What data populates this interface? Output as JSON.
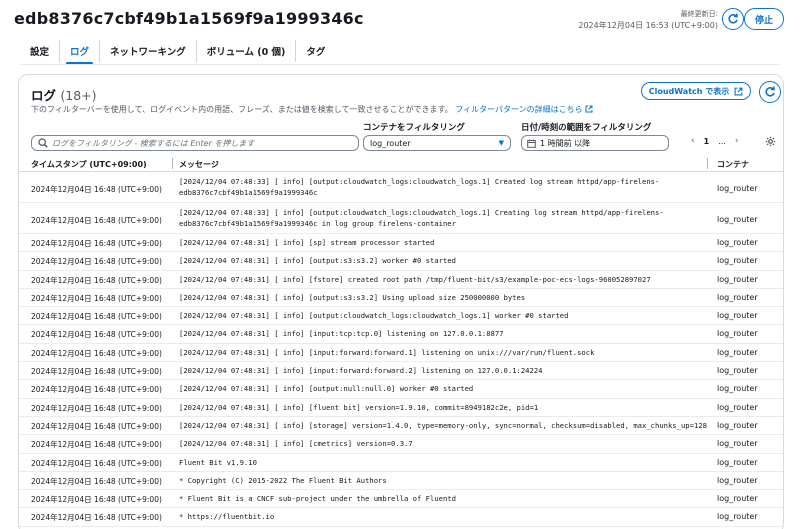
{
  "header": {
    "task_id": "edb8376c7cbf49b1a1569f9a1999346c",
    "updated_label": "最終更新日:",
    "updated_value": "2024年12月04日 16:53 (UTC+9:00)",
    "stop_label": "停止"
  },
  "tabs": [
    {
      "label": "設定",
      "active": false
    },
    {
      "label": "ログ",
      "active": true
    },
    {
      "label": "ネットワーキング",
      "active": false
    },
    {
      "label": "ボリューム (0 個)",
      "active": false
    },
    {
      "label": "タグ",
      "active": false
    }
  ],
  "logs": {
    "title": "ログ",
    "count": "(18+)",
    "description": "下のフィルターバーを使用して、ログイベント内の用語、フレーズ、または値を検索して一致させることができます。",
    "pattern_link": "フィルターパターンの詳細はこちら",
    "cloudwatch_label": "CloudWatch で表示",
    "filter_placeholder": "ログをフィルタリング - 検索するには Enter を押します",
    "container_filter_label": "コンテナをフィルタリング",
    "container_selected": "log_router",
    "date_filter_label": "日付/時刻の範囲をフィルタリング",
    "date_selected": "1 時間前 以降",
    "page_current": "1",
    "page_ellipsis": "..."
  },
  "table": {
    "columns": [
      "タイムスタンプ (UTC+09:00)",
      "メッセージ",
      "コンテナ"
    ],
    "rows": [
      {
        "ts": "2024年12月04日 16:48 (UTC+9:00)",
        "msg": "[2024/12/04 07:48:33] [ info] [output:cloudwatch_logs:cloudwatch_logs.1] Created log stream httpd/app-firelens-\nedb8376c7cbf49b1a1569f9a1999346c",
        "cont": "log_router"
      },
      {
        "ts": "2024年12月04日 16:48 (UTC+9:00)",
        "msg": "[2024/12/04 07:48:33] [ info] [output:cloudwatch_logs:cloudwatch_logs.1] Creating log stream httpd/app-firelens-\nedb8376c7cbf49b1a1569f9a1999346c in log group firelens-container",
        "cont": "log_router"
      },
      {
        "ts": "2024年12月04日 16:48 (UTC+9:00)",
        "msg": "[2024/12/04 07:48:31] [ info] [sp] stream processor started",
        "cont": "log_router"
      },
      {
        "ts": "2024年12月04日 16:48 (UTC+9:00)",
        "msg": "[2024/12/04 07:48:31] [ info] [output:s3:s3.2] worker #0 started",
        "cont": "log_router"
      },
      {
        "ts": "2024年12月04日 16:48 (UTC+9:00)",
        "msg": "[2024/12/04 07:48:31] [ info] [fstore] created root path /tmp/fluent-bit/s3/example-poc-ecs-logs-960052897027",
        "cont": "log_router"
      },
      {
        "ts": "2024年12月04日 16:48 (UTC+9:00)",
        "msg": "[2024/12/04 07:48:31] [ info] [output:s3:s3.2] Using upload size 250000000 bytes",
        "cont": "log_router"
      },
      {
        "ts": "2024年12月04日 16:48 (UTC+9:00)",
        "msg": "[2024/12/04 07:48:31] [ info] [output:cloudwatch_logs:cloudwatch_logs.1] worker #0 started",
        "cont": "log_router"
      },
      {
        "ts": "2024年12月04日 16:48 (UTC+9:00)",
        "msg": "[2024/12/04 07:48:31] [ info] [input:tcp:tcp.0] listening on 127.0.0.1:8877",
        "cont": "log_router"
      },
      {
        "ts": "2024年12月04日 16:48 (UTC+9:00)",
        "msg": "[2024/12/04 07:48:31] [ info] [input:forward:forward.1] listening on unix:///var/run/fluent.sock",
        "cont": "log_router"
      },
      {
        "ts": "2024年12月04日 16:48 (UTC+9:00)",
        "msg": "[2024/12/04 07:48:31] [ info] [input:forward:forward.2] listening on 127.0.0.1:24224",
        "cont": "log_router"
      },
      {
        "ts": "2024年12月04日 16:48 (UTC+9:00)",
        "msg": "[2024/12/04 07:48:31] [ info] [output:null:null.0] worker #0 started",
        "cont": "log_router"
      },
      {
        "ts": "2024年12月04日 16:48 (UTC+9:00)",
        "msg": "[2024/12/04 07:48:31] [ info] [fluent bit] version=1.9.10, commit=8949182c2e, pid=1",
        "cont": "log_router"
      },
      {
        "ts": "2024年12月04日 16:48 (UTC+9:00)",
        "msg": "[2024/12/04 07:48:31] [ info] [storage] version=1.4.0, type=memory-only, sync=normal, checksum=disabled, max_chunks_up=128",
        "cont": "log_router"
      },
      {
        "ts": "2024年12月04日 16:48 (UTC+9:00)",
        "msg": "[2024/12/04 07:48:31] [ info] [cmetrics] version=0.3.7",
        "cont": "log_router"
      },
      {
        "ts": "2024年12月04日 16:48 (UTC+9:00)",
        "msg": "Fluent Bit v1.9.10",
        "cont": "log_router"
      },
      {
        "ts": "2024年12月04日 16:48 (UTC+9:00)",
        "msg": "* Copyright (C) 2015-2022 The Fluent Bit Authors",
        "cont": "log_router"
      },
      {
        "ts": "2024年12月04日 16:48 (UTC+9:00)",
        "msg": "* Fluent Bit is a CNCF sub-project under the umbrella of Fluentd",
        "cont": "log_router"
      },
      {
        "ts": "2024年12月04日 16:48 (UTC+9:00)",
        "msg": "* https://fluentbit.io",
        "cont": "log_router"
      }
    ]
  }
}
